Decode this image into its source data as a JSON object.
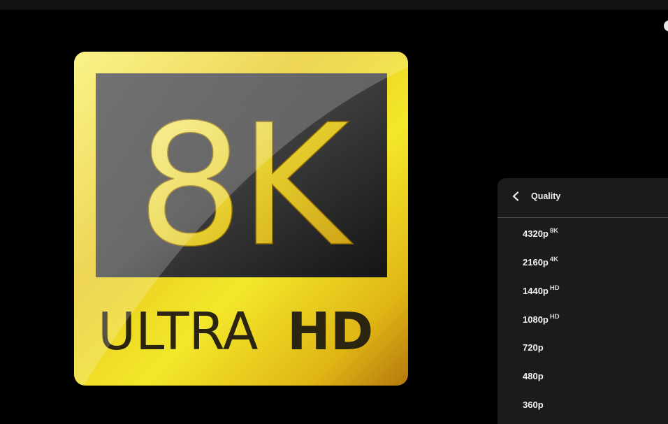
{
  "video": {
    "badge_main": "8K",
    "badge_sub_light": "ULTRA",
    "badge_sub_bold": "HD"
  },
  "quality_menu": {
    "title": "Quality",
    "back_icon": "chevron-left-icon",
    "options": [
      {
        "label": "4320p",
        "badge": "8K"
      },
      {
        "label": "2160p",
        "badge": "4K"
      },
      {
        "label": "1440p",
        "badge": "HD"
      },
      {
        "label": "1080p",
        "badge": "HD"
      },
      {
        "label": "720p",
        "badge": ""
      },
      {
        "label": "480p",
        "badge": ""
      },
      {
        "label": "360p",
        "badge": ""
      }
    ]
  },
  "colors": {
    "gold": "#f2e12a",
    "gold_dark": "#b08a10",
    "menu_background": "#1c1c1c",
    "text": "#f1f1f1"
  }
}
